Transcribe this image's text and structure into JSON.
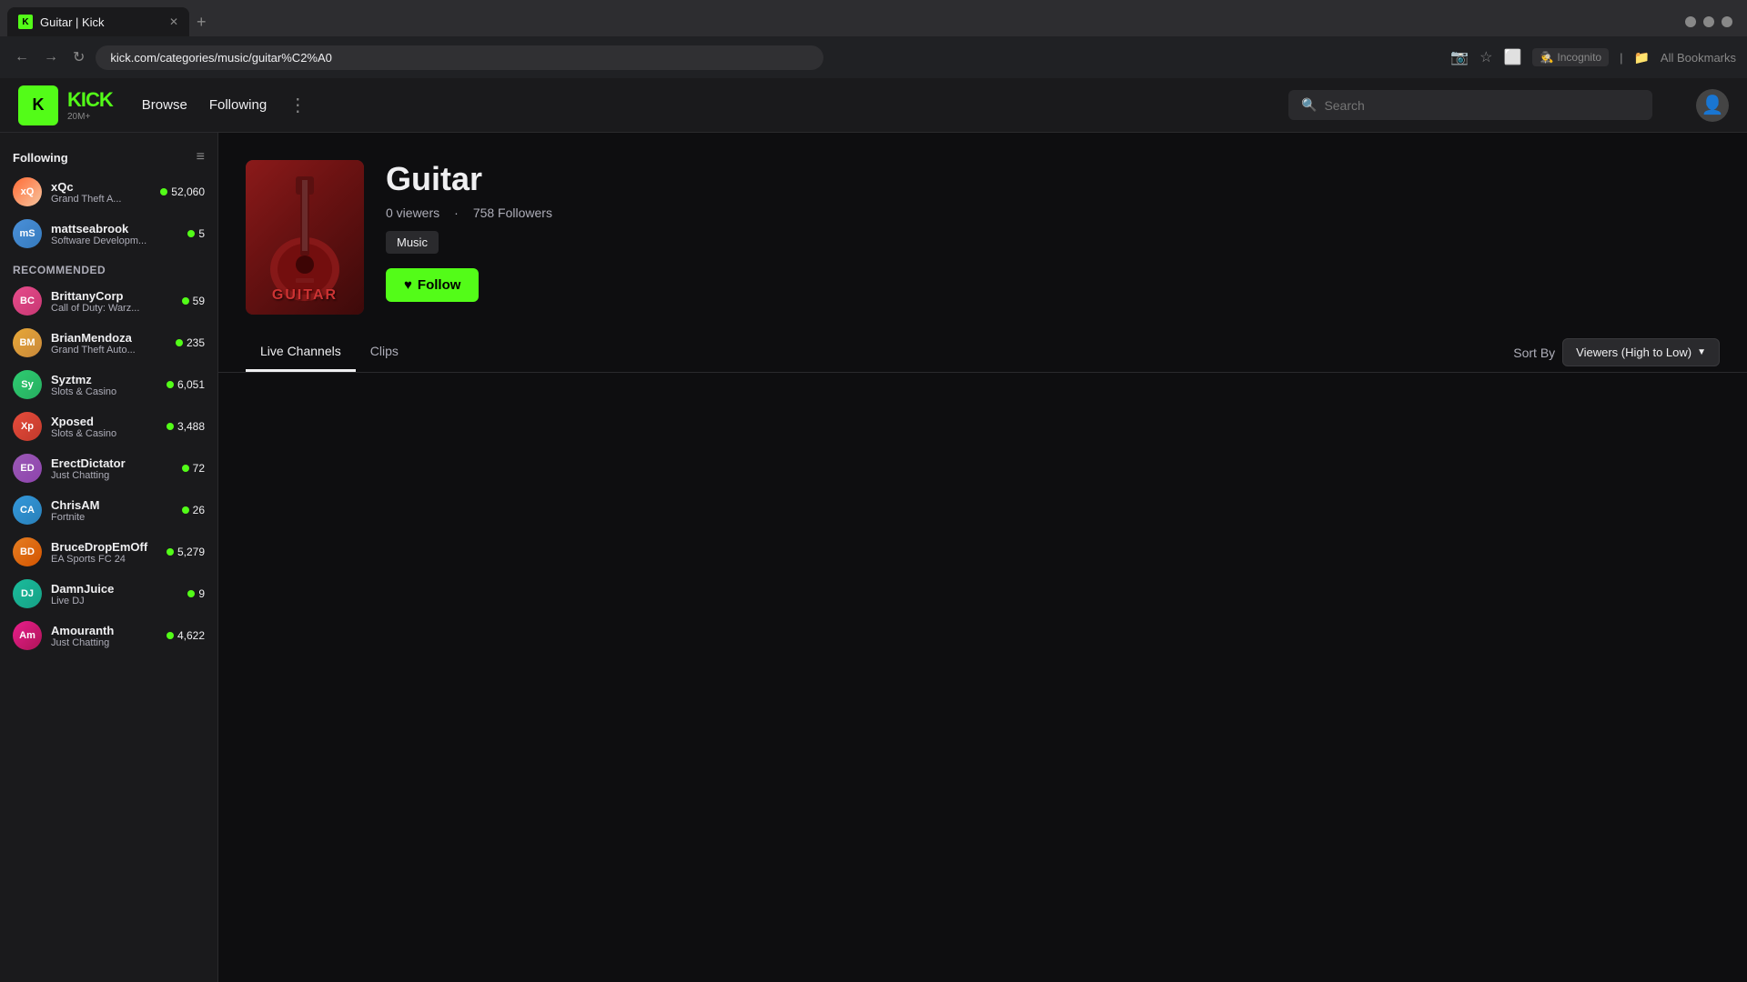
{
  "browser": {
    "tab_title": "Guitar | Kick",
    "tab_favicon": "K",
    "url": "kick.com/categories/music/guitar%C2%A0",
    "incognito_label": "Incognito",
    "bookmarks_label": "All Bookmarks"
  },
  "header": {
    "logo": "KICK",
    "logo_sub": "20M+",
    "nav": {
      "browse": "Browse",
      "following": "Following"
    },
    "search_placeholder": "Search",
    "search_label": "Search"
  },
  "sidebar": {
    "following_label": "Following",
    "recommended_label": "Recommended",
    "following_items": [
      {
        "name": "xQc",
        "game": "Grand Theft A...",
        "viewers": "52,060",
        "avatar_class": "av-xqc"
      },
      {
        "name": "mattseabrook",
        "game": "Software Developm...",
        "viewers": "5",
        "avatar_class": "av-matt"
      }
    ],
    "recommended_items": [
      {
        "name": "BrittanyCorp",
        "game": "Call of Duty: Warz...",
        "viewers": "59",
        "avatar_class": "av-brittany"
      },
      {
        "name": "BrianMendoza",
        "game": "Grand Theft Auto...",
        "viewers": "235",
        "avatar_class": "av-brian"
      },
      {
        "name": "Syztmz",
        "game": "Slots & Casino",
        "viewers": "6,051",
        "avatar_class": "av-syztmz"
      },
      {
        "name": "Xposed",
        "game": "Slots & Casino",
        "viewers": "3,488",
        "avatar_class": "av-xposed"
      },
      {
        "name": "ErectDictator",
        "game": "Just Chatting",
        "viewers": "72",
        "avatar_class": "av-erect"
      },
      {
        "name": "ChrisAM",
        "game": "Fortnite",
        "viewers": "26",
        "avatar_class": "av-chris"
      },
      {
        "name": "BruceDropEmOff",
        "game": "EA Sports FC 24",
        "viewers": "5,279",
        "avatar_class": "av-bruce"
      },
      {
        "name": "DamnJuice",
        "game": "Live DJ",
        "viewers": "9",
        "avatar_class": "av-damn"
      },
      {
        "name": "Amouranth",
        "game": "Just Chatting",
        "viewers": "4,622",
        "avatar_class": "av-amouranth"
      }
    ]
  },
  "category": {
    "title": "Guitar",
    "viewers": "0 viewers",
    "followers": "758 Followers",
    "tag": "Music",
    "follow_btn": "Follow",
    "thumbnail_label": "GUITAR"
  },
  "tabs": {
    "live_channels": "Live Channels",
    "clips": "Clips"
  },
  "sort": {
    "label": "Sort By",
    "value": "Viewers (High to Low)"
  }
}
